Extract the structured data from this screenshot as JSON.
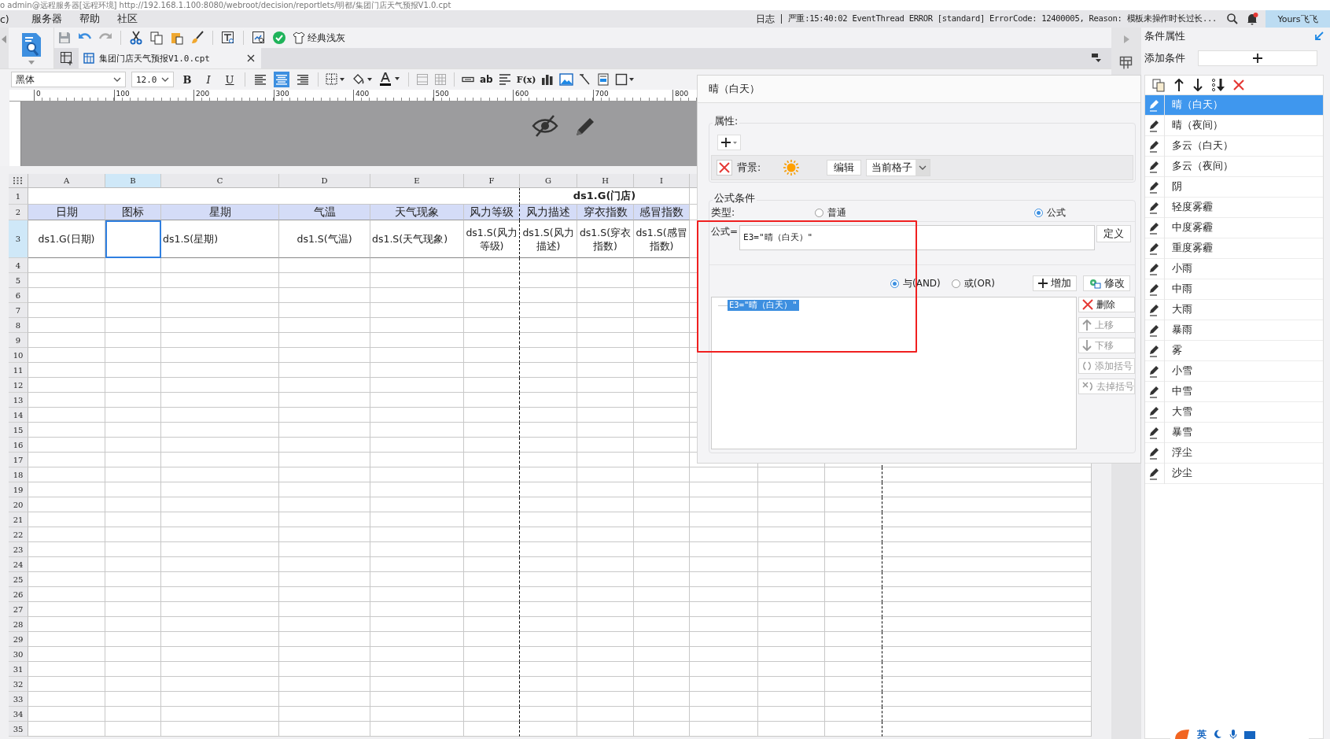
{
  "title_bar": {
    "text": "o admin@远程服务器[远程环境]    http://192.168.1.100:8080/webroot/decision/reportlets/明都/集团门店天气预报V1.0.cpt"
  },
  "menu": [
    {
      "label": "c)"
    },
    {
      "label": "服务器"
    },
    {
      "label": "帮助"
    },
    {
      "label": "社区"
    }
  ],
  "log": {
    "label": "日志",
    "message": "严重:15:40:02 EventThread ERROR [standard] ErrorCode: 12400005, Reason: 模板未操作时长过长..."
  },
  "user": {
    "name": "Yours飞飞"
  },
  "toolbar": {
    "theme_button": "经典浅灰"
  },
  "file_tab": {
    "label": "集团门店天气预报V1.0.cpt"
  },
  "format_bar": {
    "font": "黑体",
    "size": "12.0",
    "styles": [
      {
        "label": "B"
      },
      {
        "label": "I"
      },
      {
        "label": "U"
      }
    ],
    "align": [
      {
        "selected": false
      },
      {
        "selected": true
      },
      {
        "selected": false
      }
    ],
    "text_tools": [
      {
        "label": "ab"
      },
      {
        "label": "F(x)"
      }
    ]
  },
  "ruler": {
    "ticks": [
      "0",
      "100",
      "200",
      "300",
      "400",
      "500",
      "600",
      "700",
      "800"
    ]
  },
  "sheet": {
    "columns": [
      {
        "label": "A",
        "selected": false
      },
      {
        "label": "B",
        "selected": true
      },
      {
        "label": "C",
        "selected": false
      },
      {
        "label": "D",
        "selected": false
      },
      {
        "label": "E",
        "selected": false
      },
      {
        "label": "F",
        "selected": false
      },
      {
        "label": "G",
        "selected": false
      },
      {
        "label": "H",
        "selected": false
      },
      {
        "label": "I",
        "selected": false
      }
    ],
    "rows": [
      {
        "label": "1",
        "selected": false
      },
      {
        "label": "2",
        "selected": false
      },
      {
        "label": "3",
        "selected": true
      },
      {
        "label": "4",
        "selected": false
      },
      {
        "label": "5",
        "selected": false
      },
      {
        "label": "6",
        "selected": false
      },
      {
        "label": "7",
        "selected": false
      },
      {
        "label": "8",
        "selected": false
      },
      {
        "label": "9",
        "selected": false
      },
      {
        "label": "10",
        "selected": false
      },
      {
        "label": "11",
        "selected": false
      },
      {
        "label": "12",
        "selected": false
      },
      {
        "label": "13",
        "selected": false
      },
      {
        "label": "14",
        "selected": false
      },
      {
        "label": "15",
        "selected": false
      },
      {
        "label": "16",
        "selected": false
      },
      {
        "label": "17",
        "selected": false
      },
      {
        "label": "18",
        "selected": false
      },
      {
        "label": "19",
        "selected": false
      },
      {
        "label": "20",
        "selected": false
      },
      {
        "label": "21",
        "selected": false
      },
      {
        "label": "22",
        "selected": false
      },
      {
        "label": "23",
        "selected": false
      },
      {
        "label": "24",
        "selected": false
      },
      {
        "label": "25",
        "selected": false
      },
      {
        "label": "26",
        "selected": false
      },
      {
        "label": "27",
        "selected": false
      },
      {
        "label": "28",
        "selected": false
      },
      {
        "label": "29",
        "selected": false
      },
      {
        "label": "30",
        "selected": false
      },
      {
        "label": "31",
        "selected": false
      },
      {
        "label": "32",
        "selected": false
      },
      {
        "label": "33",
        "selected": false
      },
      {
        "label": "34",
        "selected": false
      },
      {
        "label": "35",
        "selected": false
      }
    ],
    "title_cell": "ds1.G(门店)",
    "header_cells": [
      "日期",
      "图标",
      "星期",
      "气温",
      "天气现象",
      "风力等级",
      "风力描述",
      "穿衣指数",
      "感冒指数"
    ],
    "data_cells": [
      {
        "text": "ds1.G(日期)",
        "selected": false
      },
      {
        "selected": true
      },
      {
        "text": "ds1.S(星期)",
        "selected": false
      },
      {
        "text": "ds1.S(气温)",
        "selected": false
      },
      {
        "text": "ds1.S(天气现象)",
        "selected": false
      },
      {
        "text": "ds1.S(风力等级)",
        "selected": false
      },
      {
        "text": "ds1.S(风力描述)",
        "selected": false
      },
      {
        "text": "ds1.S(穿衣指数)",
        "selected": false
      },
      {
        "text": "ds1.S(感冒指数)",
        "selected": false
      }
    ]
  },
  "dialog": {
    "title": "晴（白天）",
    "property_label": "属性:",
    "background_label": "背景:",
    "edit_button": "编辑",
    "scope": "当前格子",
    "condition_group": "公式条件",
    "type_label": "类型:",
    "types": [
      {
        "label": "普通",
        "selected": false
      },
      {
        "label": "公式",
        "selected": true
      }
    ],
    "formula_label": "公式=",
    "formula": "E3=\"晴（白天）\"",
    "define_button": "定义",
    "logic": [
      {
        "label": "与(AND)",
        "selected": true
      },
      {
        "label": "或(OR)",
        "selected": false
      }
    ],
    "add_button": "增加",
    "modify_button": "修改",
    "conditions": [
      {
        "text": "E3=\"晴（白天）\"",
        "selected": true
      }
    ],
    "side_buttons": [
      {
        "kind": "delete",
        "label": "删除",
        "disabled": false
      },
      {
        "kind": "up",
        "label": "上移",
        "disabled": true
      },
      {
        "kind": "down",
        "label": "下移",
        "disabled": true
      },
      {
        "kind": "add_paren",
        "label": "添加括号",
        "disabled": true
      },
      {
        "kind": "remove_paren",
        "label": "去掉括号",
        "disabled": true
      }
    ]
  },
  "right_panel": {
    "title": "条件属性",
    "add_label": "添加条件",
    "conditions": [
      {
        "label": "晴（白天）",
        "selected": true
      },
      {
        "label": "晴（夜间）",
        "selected": false
      },
      {
        "label": "多云（白天）",
        "selected": false
      },
      {
        "label": "多云（夜间）",
        "selected": false
      },
      {
        "label": "阴",
        "selected": false
      },
      {
        "label": "轻度雾霾",
        "selected": false
      },
      {
        "label": "中度雾霾",
        "selected": false
      },
      {
        "label": "重度雾霾",
        "selected": false
      },
      {
        "label": "小雨",
        "selected": false
      },
      {
        "label": "中雨",
        "selected": false
      },
      {
        "label": "大雨",
        "selected": false
      },
      {
        "label": "暴雨",
        "selected": false
      },
      {
        "label": "雾",
        "selected": false
      },
      {
        "label": "小雪",
        "selected": false
      },
      {
        "label": "中雪",
        "selected": false
      },
      {
        "label": "大雪",
        "selected": false
      },
      {
        "label": "暴雪",
        "selected": false
      },
      {
        "label": "浮尘",
        "selected": false
      },
      {
        "label": "沙尘",
        "selected": false
      }
    ]
  },
  "ime": {
    "label": "英"
  }
}
